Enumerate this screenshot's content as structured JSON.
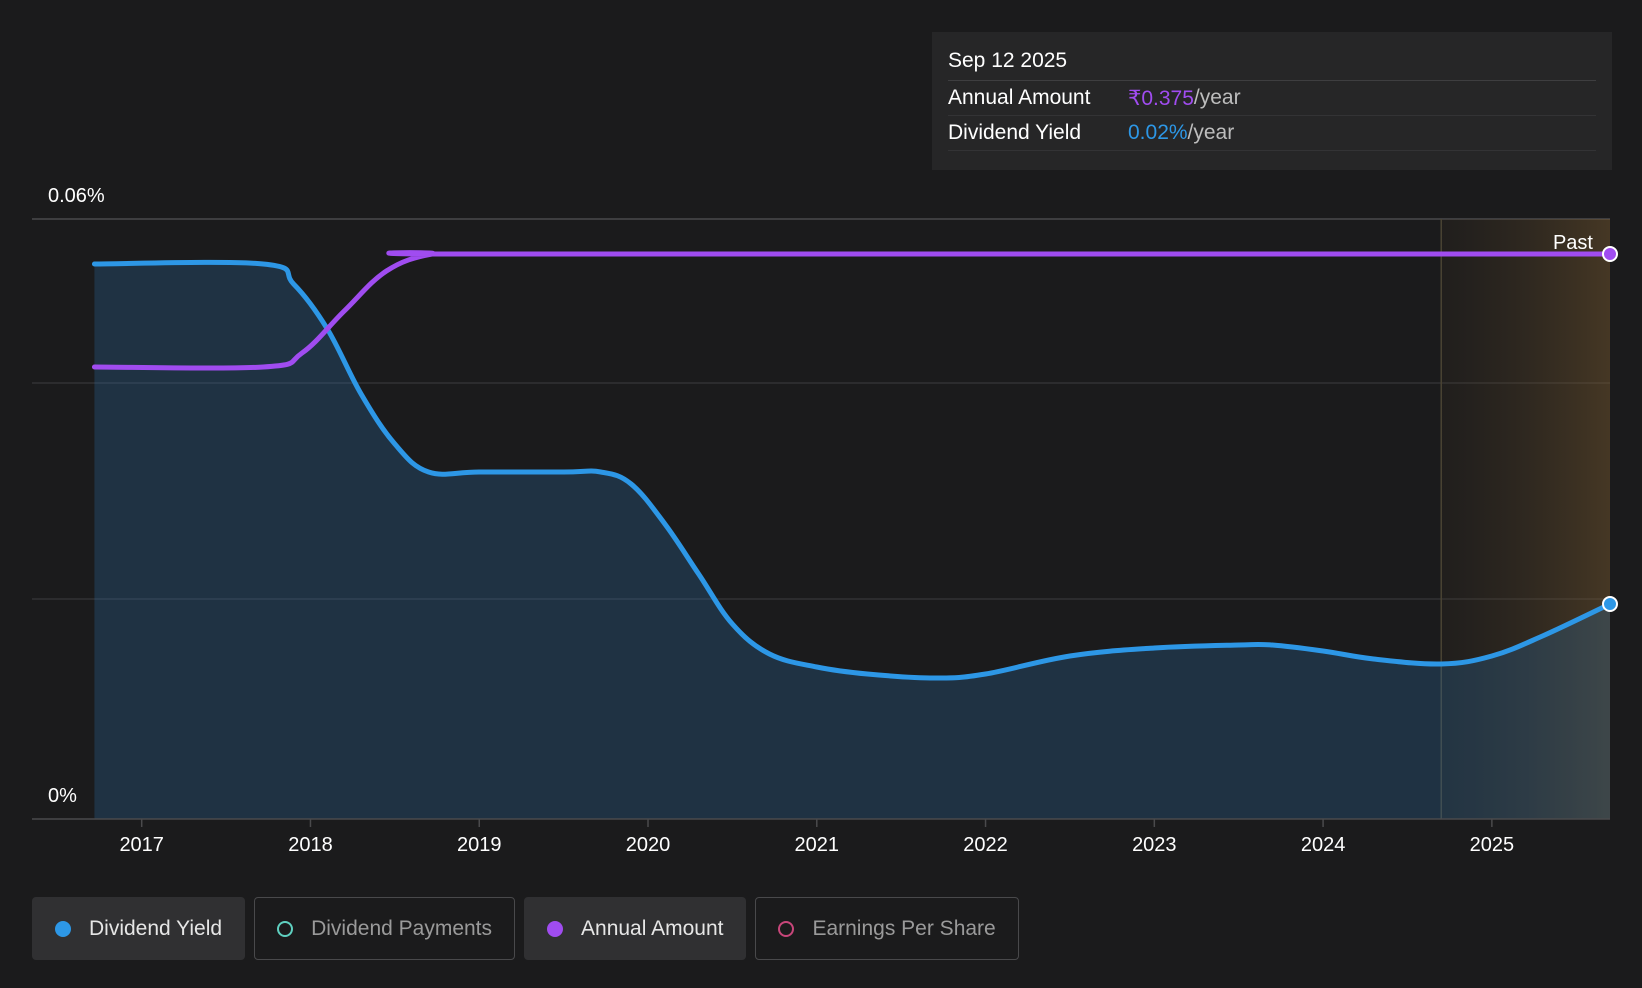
{
  "tooltip": {
    "date": "Sep 12 2025",
    "rows": [
      {
        "label": "Annual Amount",
        "value": "₹0.375",
        "suffix": "/year",
        "color": "#a04cf0"
      },
      {
        "label": "Dividend Yield",
        "value": "0.02%",
        "suffix": "/year",
        "color": "#2d97e6"
      }
    ]
  },
  "legend": [
    {
      "label": "Dividend Yield",
      "color": "#2d97e6",
      "active": true,
      "hollow": false
    },
    {
      "label": "Dividend Payments",
      "color": "#5fd0c0",
      "active": false,
      "hollow": true
    },
    {
      "label": "Annual Amount",
      "color": "#a04cf0",
      "active": true,
      "hollow": false
    },
    {
      "label": "Earnings Per Share",
      "color": "#c8467a",
      "active": false,
      "hollow": true
    }
  ],
  "chart_data": {
    "type": "line",
    "ytick_labels": [
      "0.06%",
      "0%"
    ],
    "ylim": [
      0,
      0.06
    ],
    "xlim": [
      2016.35,
      2025.7
    ],
    "xticks": [
      "2017",
      "2018",
      "2019",
      "2020",
      "2021",
      "2022",
      "2023",
      "2024",
      "2025"
    ],
    "past_label": "Past",
    "past_start": 2024.7,
    "grid": true,
    "series": [
      {
        "name": "Dividend Yield",
        "color": "#2d97e6",
        "area": true,
        "unit": "%",
        "x": [
          2016.72,
          2017.72,
          2017.9,
          2018.1,
          2018.3,
          2018.5,
          2018.7,
          2019.0,
          2019.5,
          2019.72,
          2019.9,
          2020.1,
          2020.3,
          2020.5,
          2020.72,
          2021.0,
          2021.3,
          2021.7,
          2022.0,
          2022.5,
          2023.0,
          2023.5,
          2023.7,
          2024.0,
          2024.3,
          2024.7,
          2025.0,
          2025.3,
          2025.7
        ],
        "y": [
          0.0555,
          0.0555,
          0.0535,
          0.049,
          0.0425,
          0.0375,
          0.0347,
          0.0347,
          0.0347,
          0.0347,
          0.0335,
          0.0295,
          0.0245,
          0.0195,
          0.0165,
          0.0152,
          0.0145,
          0.0141,
          0.0145,
          0.0163,
          0.0171,
          0.0174,
          0.0174,
          0.0168,
          0.016,
          0.0155,
          0.0163,
          0.0183,
          0.0215
        ]
      },
      {
        "name": "Annual Amount",
        "color": "#a04cf0",
        "area": false,
        "x": [
          2016.72,
          2017.72,
          2017.95,
          2018.2,
          2018.45,
          2018.72,
          2019.0,
          2024.7,
          2025.7
        ],
        "y": [
          0.0452,
          0.0452,
          0.0466,
          0.0508,
          0.0548,
          0.0565,
          0.0565,
          0.0565,
          0.0565
        ]
      }
    ]
  }
}
